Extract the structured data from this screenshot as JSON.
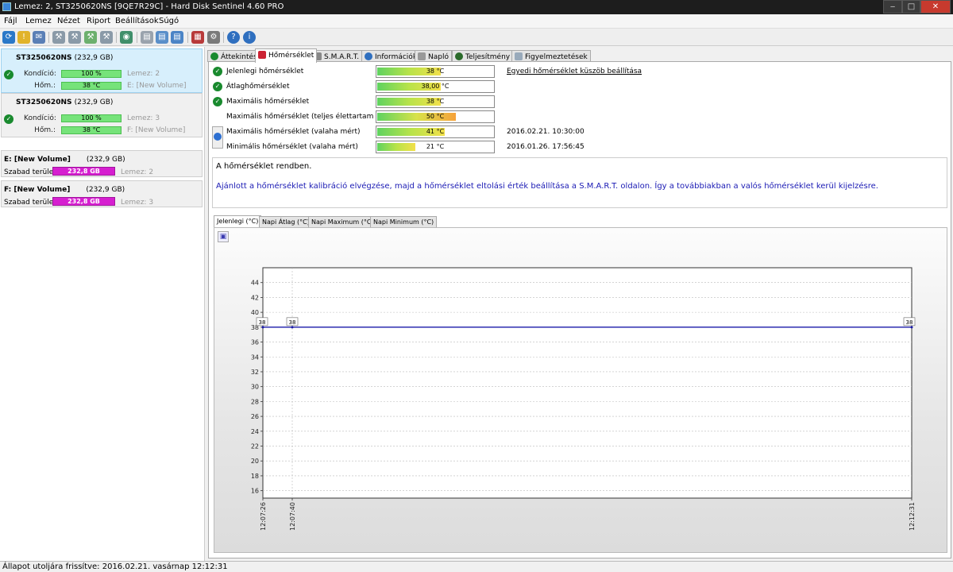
{
  "window": {
    "title": "Lemez: 2, ST3250620NS [9QE7R29C]  -  Hard Disk Sentinel 4.60 PRO"
  },
  "menu": [
    "Fájl",
    "Lemez",
    "Nézet",
    "Riport",
    "Beállítások",
    "Súgó"
  ],
  "disks": [
    {
      "name": "ST3250620NS",
      "size": "(232,9 GB)",
      "kondicio_label": "Kondíció:",
      "kondicio": "100 %",
      "kondicio_extra": "Lemez: 2",
      "hom_label": "Hőm.:",
      "hom": "38 °C",
      "hom_extra": "E: [New Volume]"
    },
    {
      "name": "ST3250620NS",
      "size": "(232,9 GB)",
      "kondicio_label": "Kondíció:",
      "kondicio": "100 %",
      "kondicio_extra": "Lemez: 3",
      "hom_label": "Hőm.:",
      "hom": "38 °C",
      "hom_extra": "F: [New Volume]"
    }
  ],
  "volumes": [
    {
      "name": "E: [New Volume]",
      "size": "(232,9 GB)",
      "free_label": "Szabad terület",
      "free": "232,8 GB",
      "disk": "Lemez: 2"
    },
    {
      "name": "F: [New Volume]",
      "size": "(232,9 GB)",
      "free_label": "Szabad terület",
      "free": "232,8 GB",
      "disk": "Lemez: 3"
    }
  ],
  "tabs": [
    "Áttekintés",
    "Hőmérséklet",
    "S.M.A.R.T.",
    "Információk",
    "Napló",
    "Teljesítmény",
    "Figyelmeztetések"
  ],
  "temps": [
    {
      "label": "Jelenlegi hőmérséklet",
      "value": "38 °C",
      "fill": 0.55,
      "date": ""
    },
    {
      "label": "Átlaghőmérséklet",
      "value": "38,00 °C",
      "fill": 0.55,
      "date": ""
    },
    {
      "label": "Maximális hőmérséklet",
      "value": "38 °C",
      "fill": 0.55,
      "date": ""
    },
    {
      "label": "Maximális hőmérséklet (teljes élettartam alatt)",
      "value": "50 °C",
      "fill": 0.68,
      "date": ""
    },
    {
      "label": "Maximális hőmérséklet (valaha mért)",
      "value": "41 °C",
      "fill": 0.58,
      "date": "2016.02.21. 10:30:00"
    },
    {
      "label": "Minimális hőmérséklet (valaha mért)",
      "value": "21 °C",
      "fill": 0.33,
      "date": "2016.01.26. 17:56:45"
    }
  ],
  "threshold_link": "Egyedi hőmérséklet küszöb beállítása",
  "message": {
    "line1": "A hőmérséklet rendben.",
    "line2": "Ajánlott a hőmérséklet kalibráció elvégzése, majd a hőmérséklet eltolási érték beállítása a S.M.A.R.T. oldalon. Így a továbbiakban a valós hőmérséklet kerül kijelzésre."
  },
  "chart_tabs": [
    "Jelenlegi (°C)",
    "Napi Átlag (°C)",
    "Napi Maximum (°C)",
    "Napi Minimum (°C)"
  ],
  "chart_data": {
    "type": "line",
    "x": [
      "12:07:26",
      "12:07:40",
      "12:12:31"
    ],
    "series": [
      {
        "values": [
          38,
          38,
          38
        ]
      }
    ],
    "data_labels": [
      "38",
      "38",
      "38"
    ],
    "yticks": [
      16,
      18,
      20,
      22,
      24,
      26,
      28,
      30,
      32,
      34,
      36,
      38,
      40,
      42,
      44
    ],
    "ylim": [
      15,
      46
    ],
    "grid": true,
    "line_color": "#1a1aa8"
  },
  "status": "Állapot utoljára frissítve: 2016.02.21. vasárnap 12:12:31"
}
